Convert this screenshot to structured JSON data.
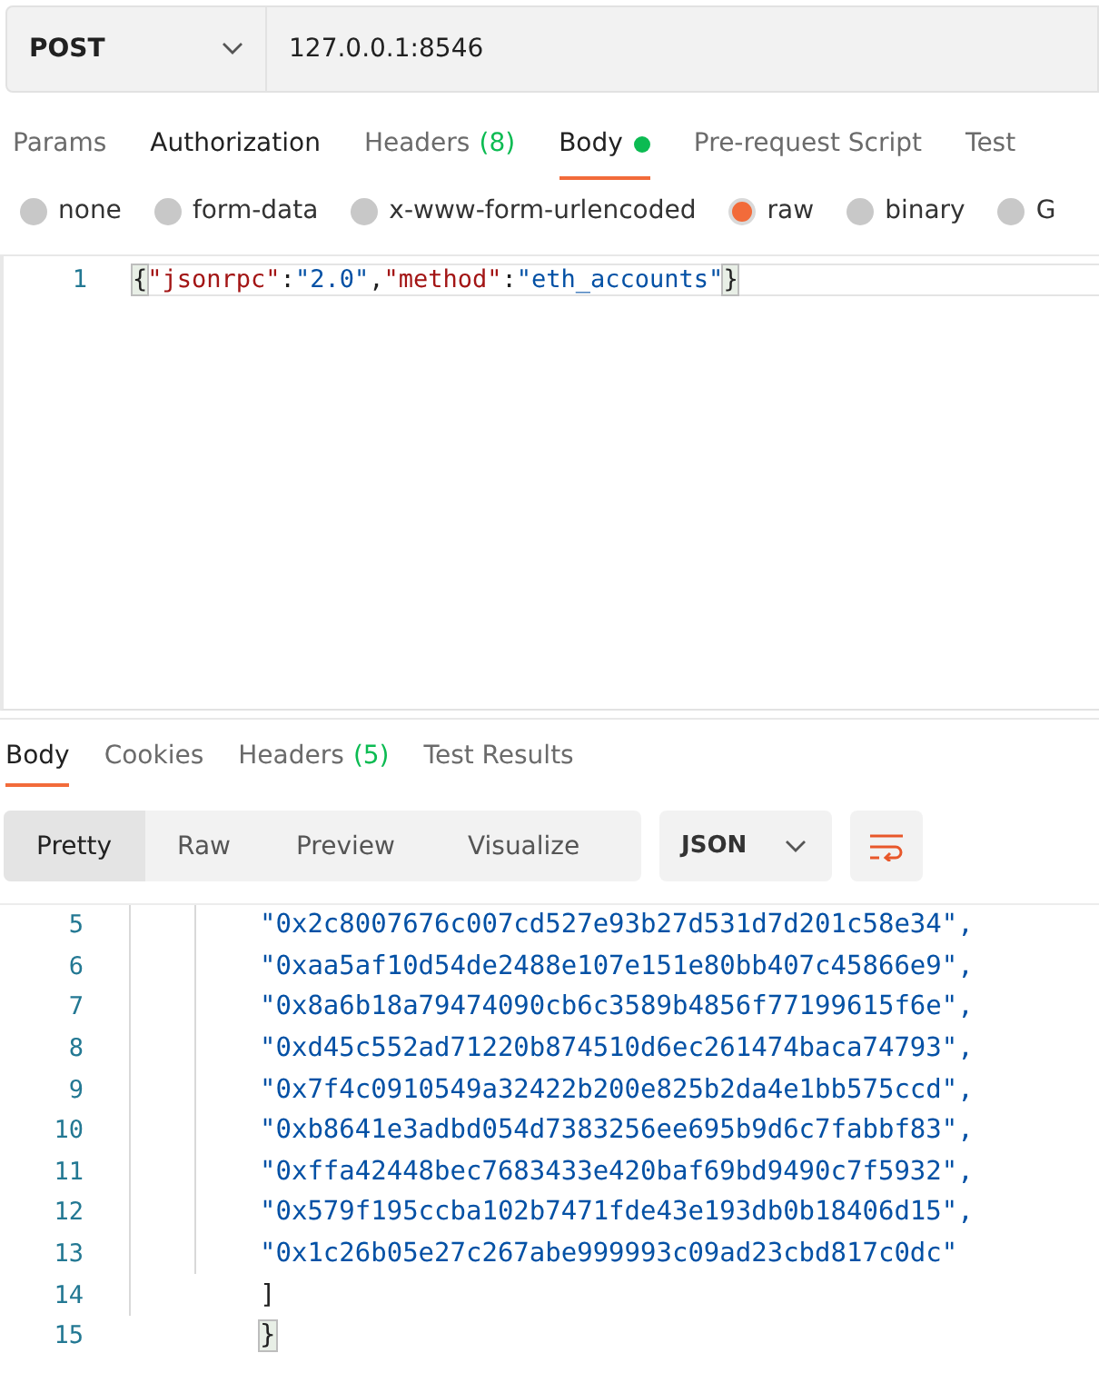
{
  "request": {
    "method": "POST",
    "url": "127.0.0.1:8546"
  },
  "request_tabs": [
    {
      "label": "Params",
      "dot": false,
      "selected": false,
      "highlighted": false
    },
    {
      "label": "Authorization",
      "dot": false,
      "selected": false,
      "highlighted": true
    },
    {
      "label": "Headers",
      "count": "(8)",
      "dot": false,
      "selected": false,
      "highlighted": false
    },
    {
      "label": "Body",
      "dot": true,
      "selected": true,
      "highlighted": true
    },
    {
      "label": "Pre-request Script",
      "dot": false,
      "selected": false,
      "highlighted": false
    },
    {
      "label": "Test",
      "dot": false,
      "selected": false,
      "highlighted": false
    }
  ],
  "body_types": [
    {
      "label": "none",
      "selected": false
    },
    {
      "label": "form-data",
      "selected": false
    },
    {
      "label": "x-www-form-urlencoded",
      "selected": false
    },
    {
      "label": "raw",
      "selected": true
    },
    {
      "label": "binary",
      "selected": false
    },
    {
      "label": "G",
      "selected": false
    }
  ],
  "request_body": {
    "lines": [
      {
        "number": "1",
        "tokens": [
          {
            "kind": "brace",
            "text": "{"
          },
          {
            "kind": "key",
            "text": "\"jsonrpc\""
          },
          {
            "kind": "punct",
            "text": ":"
          },
          {
            "kind": "string",
            "text": "\"2.0\""
          },
          {
            "kind": "punct",
            "text": ","
          },
          {
            "kind": "key",
            "text": "\"method\""
          },
          {
            "kind": "punct",
            "text": ":"
          },
          {
            "kind": "string",
            "text": "\"eth_accounts\""
          },
          {
            "kind": "brace",
            "text": "}"
          }
        ]
      }
    ]
  },
  "response_tabs": [
    {
      "label": "Body",
      "selected": true
    },
    {
      "label": "Cookies",
      "selected": false
    },
    {
      "label": "Headers",
      "count": "(5)",
      "selected": false
    },
    {
      "label": "Test Results",
      "selected": false
    }
  ],
  "view_modes": [
    {
      "label": "Pretty",
      "selected": true
    },
    {
      "label": "Raw",
      "selected": false
    },
    {
      "label": "Preview",
      "selected": false
    },
    {
      "label": "Visualize",
      "selected": false
    }
  ],
  "format": "JSON",
  "response_body": {
    "lines": [
      {
        "kind": "group",
        "children": [
          {
            "kind": "group",
            "children": [
              {
                "number": "5",
                "kind": "string",
                "text": "\"0x2c8007676c007cd527e93b27d531d7d201c58e34\","
              },
              {
                "number": "6",
                "kind": "string",
                "text": "\"0xaa5af10d54de2488e107e151e80bb407c45866e9\","
              },
              {
                "number": "7",
                "kind": "string",
                "text": "\"0x8a6b18a79474090cb6c3589b4856f77199615f6e\","
              },
              {
                "number": "8",
                "kind": "string",
                "text": "\"0xd45c552ad71220b874510d6ec261474baca74793\","
              },
              {
                "number": "9",
                "kind": "string",
                "text": "\"0x7f4c0910549a32422b200e825b2da4e1bb575ccd\","
              },
              {
                "number": "10",
                "kind": "string",
                "text": "\"0xb8641e3adbd054d7383256ee695b9d6c7fabbf83\","
              },
              {
                "number": "11",
                "kind": "string",
                "text": "\"0xffa42448bec7683433e420baf69bd9490c7f5932\","
              },
              {
                "number": "12",
                "kind": "string",
                "text": "\"0x579f195ccba102b7471fde43e193db0b18406d15\","
              },
              {
                "number": "13",
                "kind": "string",
                "text": "\"0x1c26b05e27c267abe999993c09ad23cbd817c0dc\""
              }
            ]
          },
          {
            "number": "14",
            "kind": "punct",
            "text": "]"
          }
        ]
      },
      {
        "number": "15",
        "kind": "brace",
        "text": "}"
      }
    ]
  }
}
